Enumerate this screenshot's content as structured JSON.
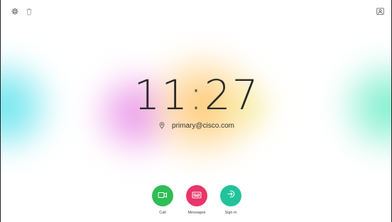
{
  "top_bar": {
    "icons": [
      "gear-icon",
      "trash-icon",
      "contact-card-icon"
    ]
  },
  "clock": {
    "hours": "11",
    "separator": ":",
    "minutes": "27"
  },
  "address": {
    "icon": "location-pin-icon",
    "text": "primary@cisco.com"
  },
  "actions": [
    {
      "label": "Call",
      "icon": "video-camera-icon",
      "color": "#2fbd55"
    },
    {
      "label": "Messages",
      "icon": "voicemail-icon",
      "color": "#e8356a"
    },
    {
      "label": "Sign in",
      "icon": "sign-in-icon",
      "color": "#22c39a"
    }
  ],
  "colors": {
    "background": "#ffffff",
    "glow_left": "#50e1eb",
    "glow_right": "#5aebbe",
    "glow_center_pink": "#e178e6",
    "glow_center_orange": "#ffbe5a"
  }
}
